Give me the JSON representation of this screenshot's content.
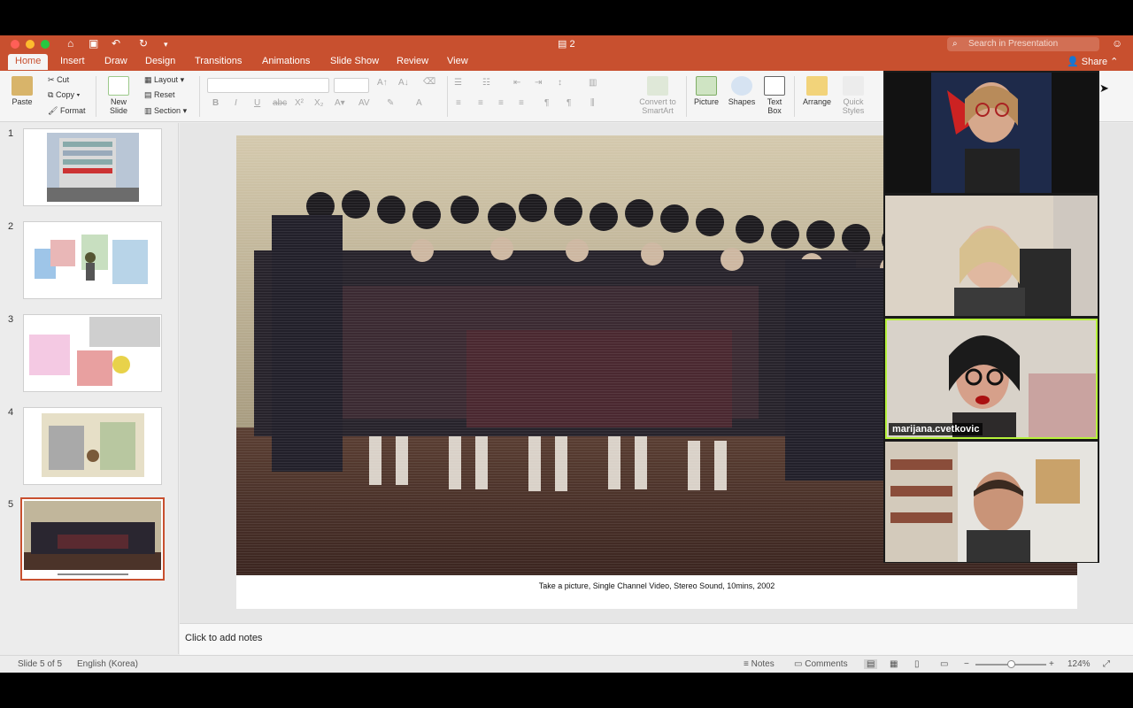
{
  "titlebar": {
    "doc_title": "2",
    "search_placeholder": "Search in Presentation"
  },
  "tabs": [
    "Home",
    "Insert",
    "Draw",
    "Design",
    "Transitions",
    "Animations",
    "Slide Show",
    "Review",
    "View"
  ],
  "active_tab": "Home",
  "share_label": "Share",
  "ribbon": {
    "paste": "Paste",
    "cut": "Cut",
    "copy": "Copy",
    "format": "Format",
    "new_slide": "New Slide",
    "layout": "Layout",
    "reset": "Reset",
    "section": "Section",
    "convert": "Convert to SmartArt",
    "picture": "Picture",
    "shapes": "Shapes",
    "text_box": "Text Box",
    "arrange": "Arrange",
    "quick_styles": "Quick Styles"
  },
  "slides": [
    {
      "num": "1"
    },
    {
      "num": "2"
    },
    {
      "num": "3"
    },
    {
      "num": "4"
    },
    {
      "num": "5",
      "selected": true
    }
  ],
  "slide": {
    "caption": "Take a picture, Single Channel Video, Stereo Sound, 10mins, 2002"
  },
  "notes_placeholder": "Click to add notes",
  "status": {
    "slide_count": "Slide 5 of 5",
    "language": "English (Korea)",
    "notes": "Notes",
    "comments": "Comments",
    "zoom": "124%"
  },
  "participants": [
    {
      "name": ""
    },
    {
      "name": ""
    },
    {
      "name": "marijana.cvetkovic",
      "active_speaker": true
    },
    {
      "name": ""
    }
  ],
  "colors": {
    "accent": "#c8502f",
    "speaker_border": "#b6f23b"
  }
}
